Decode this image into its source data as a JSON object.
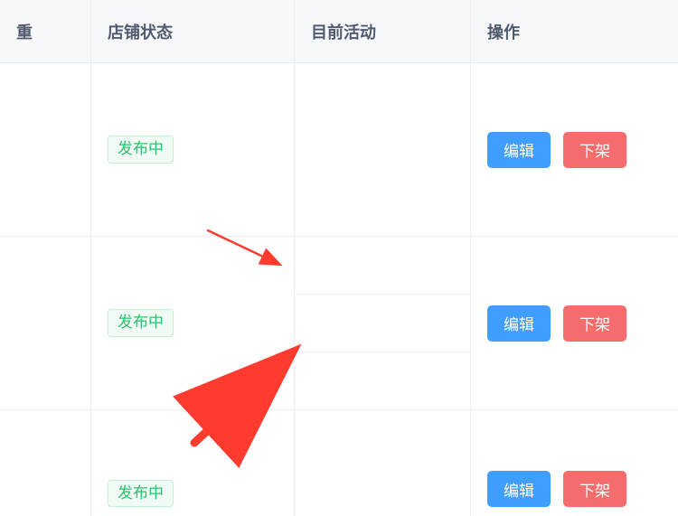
{
  "columns": {
    "weight_label": "重",
    "status_label": "店铺状态",
    "activity_label": "目前活动",
    "ops_label": "操作"
  },
  "status_tag": "发布中",
  "buttons": {
    "edit": "编辑",
    "remove": "下架"
  },
  "colors": {
    "primary": "#409eff",
    "danger": "#f56c6c",
    "tag_green": "#27c46c",
    "arrow": "#ff3b30"
  },
  "rows": [
    {
      "status": "发布中",
      "activity_slots": 1
    },
    {
      "status": "发布中",
      "activity_slots": 3
    },
    {
      "status": "发布中",
      "activity_slots": 1
    }
  ]
}
